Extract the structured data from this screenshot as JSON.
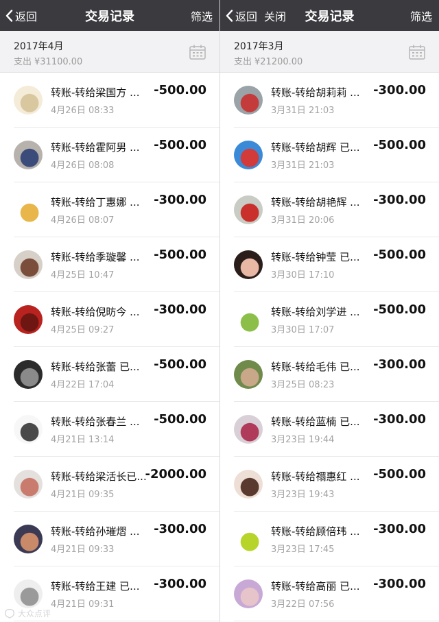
{
  "left": {
    "nav": {
      "back_label": "返回",
      "title": "交易记录",
      "filter_label": "筛选"
    },
    "month": {
      "title": "2017年4月",
      "spend_label": "支出",
      "spend_amount": "¥31100.00"
    },
    "transactions": [
      {
        "name": "转账-转给梁国方 ...",
        "time": "4月26日 08:33",
        "amount": "-500.00",
        "avatar_colors": [
          "#f4ecd9",
          "#d9c7a0"
        ]
      },
      {
        "name": "转账-转给霍阿男 ...",
        "time": "4月26日 08:08",
        "amount": "-500.00",
        "avatar_colors": [
          "#b8b2ad",
          "#3b4b7a"
        ]
      },
      {
        "name": "转账-转给丁惠娜 ...",
        "time": "4月26日 08:07",
        "amount": "-300.00",
        "avatar_colors": [
          "#ffffff",
          "#e8b64a"
        ]
      },
      {
        "name": "转账-转给季璇馨 ...",
        "time": "4月25日 10:47",
        "amount": "-500.00",
        "avatar_colors": [
          "#d7d0c8",
          "#7a4e3a"
        ]
      },
      {
        "name": "转账-转给倪昉今 ...",
        "time": "4月25日 09:27",
        "amount": "-300.00",
        "avatar_colors": [
          "#b8231f",
          "#6e1612"
        ]
      },
      {
        "name": "转账-转给张蕾 已...",
        "time": "4月22日 17:04",
        "amount": "-500.00",
        "avatar_colors": [
          "#2b2b2b",
          "#8a8a8a"
        ]
      },
      {
        "name": "转账-转给张春兰 ...",
        "time": "4月21日 13:14",
        "amount": "-500.00",
        "avatar_colors": [
          "#f7f7f7",
          "#4a4a4a"
        ]
      },
      {
        "name": "转账-转给梁活长已...",
        "time": "4月21日 09:35",
        "amount": "-2000.00",
        "avatar_colors": [
          "#e4e0de",
          "#c97b6e"
        ]
      },
      {
        "name": "转账-转给孙璀熠 ...",
        "time": "4月21日 09:33",
        "amount": "-300.00",
        "avatar_colors": [
          "#3b3a55",
          "#c98a6a"
        ]
      },
      {
        "name": "转账-转给王建 已...",
        "time": "4月21日 09:31",
        "amount": "-300.00",
        "avatar_colors": [
          "#eeeeee",
          "#9a9a9a"
        ]
      }
    ]
  },
  "right": {
    "nav": {
      "back_label": "返回",
      "close_label": "关闭",
      "title": "交易记录",
      "filter_label": "筛选"
    },
    "month": {
      "title": "2017年3月",
      "spend_label": "支出",
      "spend_amount": "¥21200.00"
    },
    "transactions": [
      {
        "name": "转账-转给胡莉莉 ...",
        "time": "3月31日 21:03",
        "amount": "-300.00",
        "avatar_colors": [
          "#9aa3a8",
          "#c43b3b"
        ]
      },
      {
        "name": "转账-转给胡辉 已...",
        "time": "3月31日 21:03",
        "amount": "-500.00",
        "avatar_colors": [
          "#3a8ad8",
          "#d33a3a"
        ]
      },
      {
        "name": "转账-转给胡艳辉 ...",
        "time": "3月31日 20:06",
        "amount": "-300.00",
        "avatar_colors": [
          "#c8ccc4",
          "#c9302c"
        ]
      },
      {
        "name": "转账-转给钟莹 已...",
        "time": "3月30日 17:10",
        "amount": "-500.00",
        "avatar_colors": [
          "#2a1d1a",
          "#e8b8a4"
        ]
      },
      {
        "name": "转账-转给刘学进 ...",
        "time": "3月30日 17:07",
        "amount": "-500.00",
        "avatar_colors": [
          "#ffffff",
          "#8cbf4a"
        ]
      },
      {
        "name": "转账-转给毛伟 已...",
        "time": "3月25日 08:23",
        "amount": "-300.00",
        "avatar_colors": [
          "#6f8a4a",
          "#c9a88a"
        ]
      },
      {
        "name": "转账-转给蓝楠 已...",
        "time": "3月23日 19:44",
        "amount": "-300.00",
        "avatar_colors": [
          "#d8d0d6",
          "#b03a5a"
        ]
      },
      {
        "name": "转账-转给禤惠红 ...",
        "time": "3月23日 19:43",
        "amount": "-500.00",
        "avatar_colors": [
          "#eedfd6",
          "#5a3a2e"
        ]
      },
      {
        "name": "转账-转给顾倍玮 ...",
        "time": "3月23日 17:45",
        "amount": "-300.00",
        "avatar_colors": [
          "#ffffff",
          "#b6d42a"
        ]
      },
      {
        "name": "转账-转给高丽 已...",
        "time": "3月22日 07:56",
        "amount": "-300.00",
        "avatar_colors": [
          "#c8a9d6",
          "#e6c4c9"
        ]
      }
    ]
  },
  "watermark": {
    "text": "大众点评",
    "icon": "watermark-logo-icon"
  },
  "colors": {
    "navbar": "#3a3a3f",
    "month_header": "#f2f2f4",
    "secondary_text": "#a3a3a3"
  },
  "icons": {
    "back": "chevron-left-icon",
    "calendar": "calendar-icon"
  }
}
